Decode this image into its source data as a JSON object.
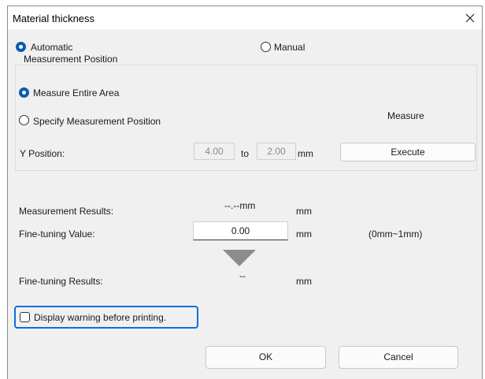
{
  "dialog": {
    "title": "Material thickness",
    "close_label": "×"
  },
  "mode": {
    "automatic_label": "Automatic",
    "manual_label": "Manual",
    "selected": "automatic"
  },
  "measurement_position": {
    "legend": "Measurement Position",
    "entire_area_label": "Measure Entire Area",
    "specify_label": "Specify Measurement Position",
    "selected": "entire_area",
    "measure_label": "Measure",
    "y_position_label": "Y Position:",
    "y_from": "4.00",
    "to_label": "to",
    "y_to": "2.00",
    "unit": "mm",
    "execute_label": "Execute"
  },
  "results": {
    "measurement_label": "Measurement Results:",
    "measurement_value": "--.--mm",
    "measurement_unit": "mm",
    "fine_tuning_label": "Fine-tuning Value:",
    "fine_tuning_value": "0.00",
    "fine_tuning_unit": "mm",
    "fine_tuning_range": "(0mm~1mm)",
    "fine_tuning_results_label": "Fine-tuning Results:",
    "fine_tuning_results_value": "--",
    "fine_tuning_results_unit": "mm"
  },
  "warning": {
    "label": "Display warning before printing.",
    "checked": false
  },
  "buttons": {
    "ok_label": "OK",
    "cancel_label": "Cancel"
  },
  "colors": {
    "accent": "#0a5ab4",
    "focus_ring": "#0b6fe0",
    "dialog_bg": "#f0f0f0"
  }
}
